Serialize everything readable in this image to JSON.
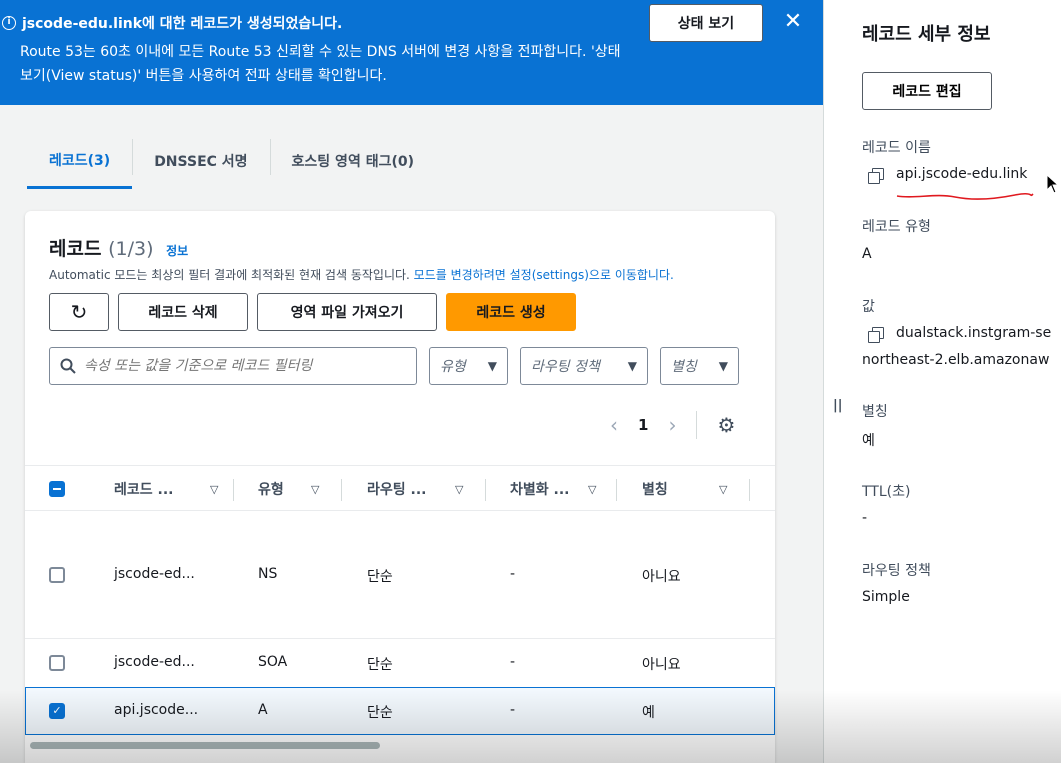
{
  "flash": {
    "title": "jscode-edu.link에 대한 레코드가 생성되었습니다.",
    "body": "Route 53는 60초 이내에 모든 Route 53 신뢰할 수 있는 DNS 서버에 변경 사항을 전파합니다. '상태 보기(View status)' 버튼을 사용하여 전파 상태를 확인합니다.",
    "status_button": "상태 보기",
    "close": "✕",
    "info_glyph": "i"
  },
  "tabs": [
    {
      "label": "레코드(3)",
      "active": true
    },
    {
      "label": "DNSSEC 서명",
      "active": false
    },
    {
      "label": "호스팅 영역 태그(0)",
      "active": false
    }
  ],
  "records_panel": {
    "title": "레코드",
    "count": "(1/3)",
    "info_link": "정보",
    "description": "Automatic 모드는 최상의 필터 결과에 최적화된 현재 검색 동작입니다.",
    "description_link": "모드를 변경하려면 설정(settings)으로 이동합니다.",
    "buttons": {
      "refresh": "↻",
      "delete": "레코드 삭제",
      "import": "영역 파일 가져오기",
      "create": "레코드 생성"
    },
    "filter_placeholder": "속성 또는 값을 기준으로 레코드 필터링",
    "selects": {
      "type": "유형",
      "routing": "라우팅 정책",
      "alias": "별칭"
    },
    "pagination": {
      "prev": "‹",
      "page": "1",
      "next": "›",
      "settings_icon": "⚙"
    }
  },
  "table": {
    "columns": [
      "레코드 ...",
      "유형",
      "라우팅 ...",
      "차별화 ...",
      "별칭"
    ],
    "sort_glyph": "▽",
    "rows": [
      {
        "name": "jscode-ed...",
        "type": "NS",
        "routing": "단순",
        "diff": "-",
        "alias": "아니요",
        "selected": false
      },
      {
        "name": "jscode-ed...",
        "type": "SOA",
        "routing": "단순",
        "diff": "-",
        "alias": "아니요",
        "selected": false
      },
      {
        "name": "api.jscode...",
        "type": "A",
        "routing": "단순",
        "diff": "-",
        "alias": "예",
        "selected": true
      }
    ]
  },
  "details": {
    "title": "레코드 세부 정보",
    "edit_button": "레코드 편집",
    "record_name_label": "레코드 이름",
    "record_name": "api.jscode-edu.link",
    "record_type_label": "레코드 유형",
    "record_type": "A",
    "value_label": "값",
    "value_line1": "dualstack.instgram-se",
    "value_line2": "northeast-2.elb.amazonaw",
    "alias_label": "별칭",
    "alias": "예",
    "ttl_label": "TTL(초)",
    "ttl": "-",
    "routing_label": "라우팅 정책",
    "routing": "Simple",
    "grip": "||"
  },
  "colors": {
    "flash_bg": "#0972d3",
    "primary": "#ff9900",
    "link": "#0972d3",
    "annotation": "#e0191f"
  }
}
